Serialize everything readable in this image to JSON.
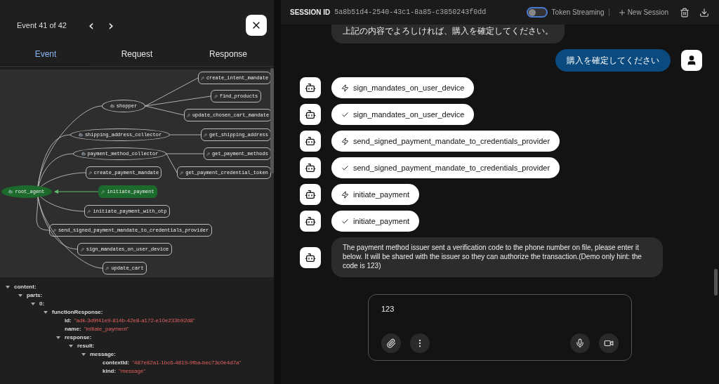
{
  "event_panel": {
    "counter": "Event 41 of 42",
    "prev": "‹",
    "next": "›",
    "tabs": [
      {
        "label": "Event",
        "selected": true
      },
      {
        "label": "Request",
        "selected": false
      },
      {
        "label": "Response",
        "selected": false
      }
    ],
    "graph": {
      "nodes": [
        {
          "label": "root_agent",
          "kind": "agent",
          "highlighted": true,
          "children": [
            {
              "label": "shopper",
              "kind": "agent",
              "highlighted": false,
              "children": [
                {
                  "label": "create_intent_mandate",
                  "kind": "tool",
                  "highlighted": false
                },
                {
                  "label": "find_products",
                  "kind": "tool",
                  "highlighted": false
                },
                {
                  "label": "update_chosen_cart_mandate",
                  "kind": "tool",
                  "highlighted": false
                }
              ]
            },
            {
              "label": "shipping_address_collector",
              "kind": "agent",
              "highlighted": false,
              "children": [
                {
                  "label": "get_shipping_address",
                  "kind": "tool",
                  "highlighted": false
                }
              ]
            },
            {
              "label": "payment_method_collector",
              "kind": "agent",
              "highlighted": false,
              "children": [
                {
                  "label": "get_payment_methods",
                  "kind": "tool",
                  "highlighted": false
                },
                {
                  "label": "get_payment_credential_token",
                  "kind": "tool",
                  "highlighted": false
                }
              ]
            },
            {
              "label": "create_payment_mandate",
              "kind": "tool",
              "highlighted": false
            },
            {
              "label": "initiate_payment",
              "kind": "tool",
              "highlighted": true
            },
            {
              "label": "initiate_payment_with_otp",
              "kind": "tool",
              "highlighted": false
            },
            {
              "label": "send_signed_payment_mandate_to_credentials_provider",
              "kind": "tool",
              "highlighted": false
            },
            {
              "label": "sign_mandates_on_user_device",
              "kind": "tool",
              "highlighted": false
            },
            {
              "label": "update_cart",
              "kind": "tool",
              "highlighted": false
            }
          ]
        }
      ]
    },
    "tree": [
      {
        "key": "content:",
        "expanded": true,
        "children": [
          {
            "key": "parts:",
            "expanded": true,
            "children": [
              {
                "key": "0:",
                "expanded": true,
                "children": [
                  {
                    "key": "functionResponse:",
                    "expanded": true,
                    "children": [
                      {
                        "key": "id:",
                        "value": "\"adk-3d9f41e9-814b-42e8-a172-e10e233b92d8\""
                      },
                      {
                        "key": "name:",
                        "value": "\"initiate_payment\""
                      },
                      {
                        "key": "response:",
                        "expanded": true,
                        "children": [
                          {
                            "key": "result:",
                            "expanded": true,
                            "children": [
                              {
                                "key": "message:",
                                "expanded": true,
                                "children": [
                                  {
                                    "key": "contextId:",
                                    "value": "\"487e82a1-1bc6-4819-9fba-bec73c0e4d7a\""
                                  },
                                  {
                                    "key": "kind:",
                                    "value": "\"message\""
                                  }
                                ]
                              }
                            ]
                          }
                        ]
                      }
                    ]
                  }
                ]
              }
            ]
          }
        ]
      }
    ]
  },
  "chat": {
    "session_label": "SESSION ID",
    "session_id": "5a8b51d4-2540-43c1-8a85-c3850243f0dd",
    "token_streaming": {
      "label": "Token Streaming",
      "on": false
    },
    "new_session": "New Session",
    "messages": [
      {
        "kind": "bot_text",
        "text": "上記の内容でよろしければ、購入を確定してください。",
        "cut": true
      },
      {
        "kind": "user",
        "text": "購入を確定してください"
      },
      {
        "kind": "call",
        "text": "sign_mandates_on_user_device"
      },
      {
        "kind": "result",
        "text": "sign_mandates_on_user_device"
      },
      {
        "kind": "call",
        "text": "send_signed_payment_mandate_to_credentials_provider"
      },
      {
        "kind": "result",
        "text": "send_signed_payment_mandate_to_credentials_provider"
      },
      {
        "kind": "call",
        "text": "initiate_payment"
      },
      {
        "kind": "result",
        "text": "initiate_payment"
      },
      {
        "kind": "bot_text",
        "text": "The payment method issuer sent a verification code to the phone number on file, please enter it below. It will be shared with the issuer so they can authorize the transaction.(Demo only hint: the code is 123)",
        "cut": false
      }
    ],
    "input": {
      "value": "123"
    }
  }
}
